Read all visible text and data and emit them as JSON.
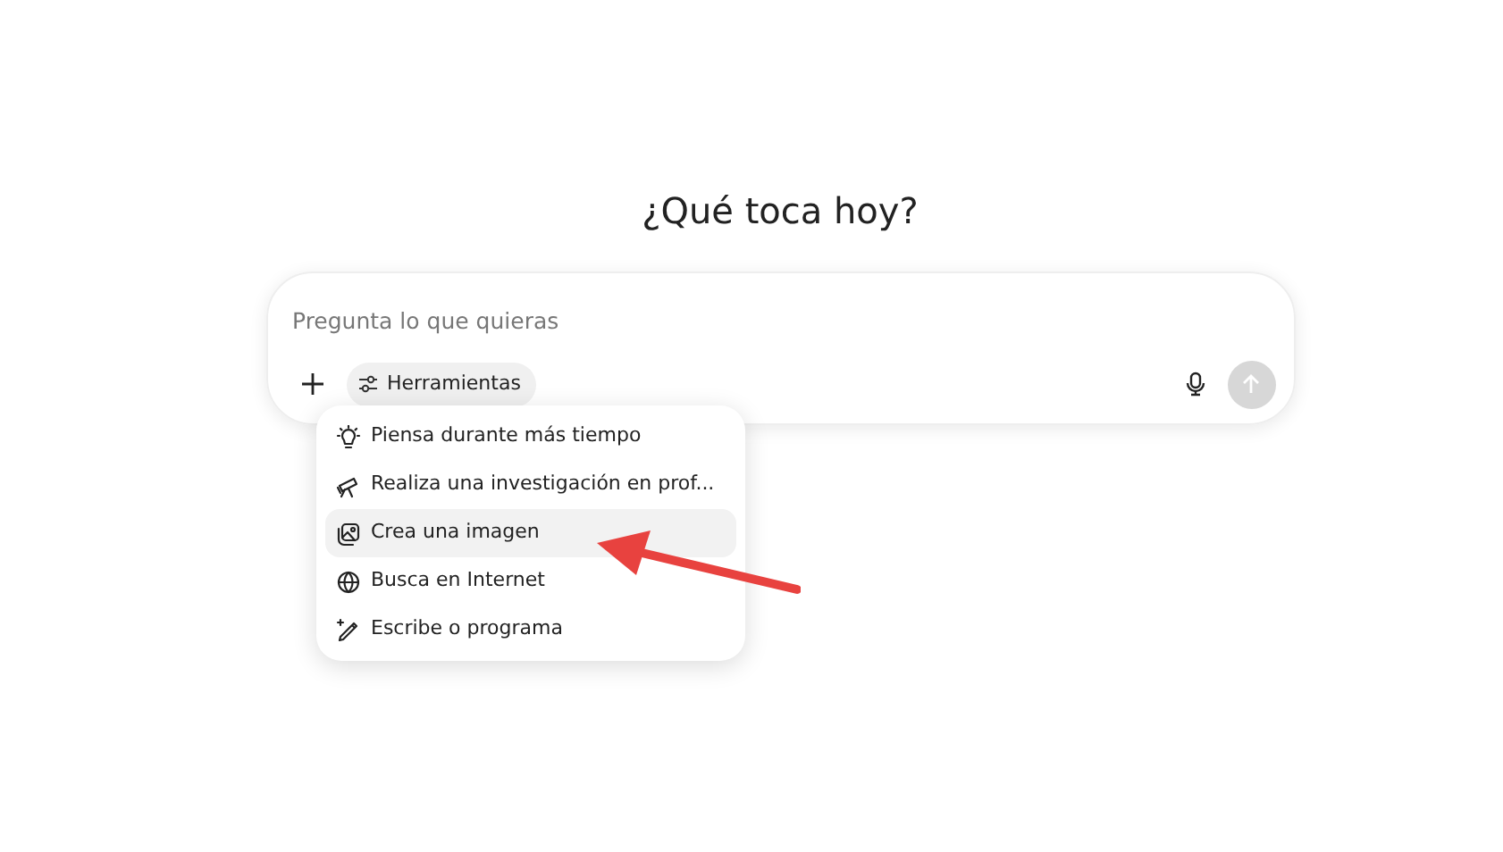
{
  "heading": "¿Qué toca hoy?",
  "composer": {
    "placeholder": "Pregunta lo que quieras",
    "tools_button": "Herramientas",
    "send_disabled": true
  },
  "tools_menu": [
    {
      "kind": "bulb",
      "label": "Piensa durante más tiempo",
      "selected": false
    },
    {
      "kind": "telescope",
      "label": "Realiza una investigación en prof...",
      "selected": false
    },
    {
      "kind": "image",
      "label": "Crea una imagen",
      "selected": true
    },
    {
      "kind": "globe",
      "label": "Busca en Internet",
      "selected": false
    },
    {
      "kind": "pen",
      "label": "Escribe o programa",
      "selected": false
    }
  ],
  "annotation": {
    "kind": "arrow",
    "color": "#e8423f"
  }
}
